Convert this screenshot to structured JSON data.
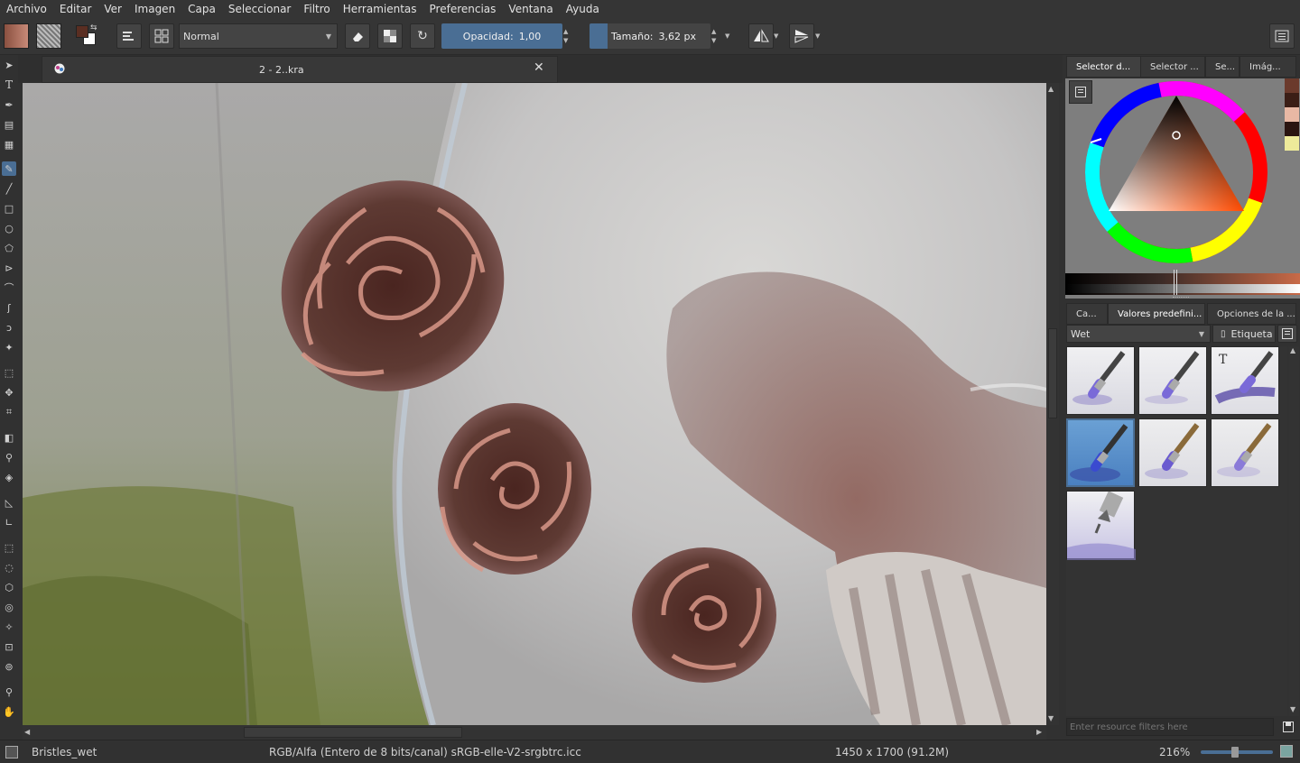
{
  "menu": [
    "Archivo",
    "Editar",
    "Ver",
    "Imagen",
    "Capa",
    "Seleccionar",
    "Filtro",
    "Herramientas",
    "Preferencias",
    "Ventana",
    "Ayuda"
  ],
  "toolbar": {
    "blend_mode": "Normal",
    "opacity_label": "Opacidad:",
    "opacity_value": "1,00",
    "size_label": "Tamaño:",
    "size_value": "3,62 px"
  },
  "document": {
    "tab_title": "2 - 2..kra"
  },
  "color_panel": {
    "tabs": [
      "Selector d...",
      "Selector ...",
      "Se...",
      "Imág..."
    ],
    "swatches": [
      "#6b3a2c",
      "#3b1e16",
      "#e8b8a4",
      "#2a1410",
      "#eeea9a"
    ]
  },
  "brush_panel": {
    "tabs": [
      "Ca...",
      "Valores predefini...",
      "Opciones de la ..."
    ],
    "filter_value": "Wet",
    "tag_label": "Etiqueta",
    "search_placeholder": "Enter resource filters here"
  },
  "status": {
    "brush_name": "Bristles_wet",
    "color_space": "RGB/Alfa (Entero de 8 bits/canal)  sRGB-elle-V2-srgbtrc.icc",
    "dimensions": "1450 x 1700 (91.2M)",
    "zoom": "216%"
  },
  "colors": {
    "accent": "#4a6e94",
    "foreground": "#5a2e22",
    "background": "#ffffff"
  }
}
